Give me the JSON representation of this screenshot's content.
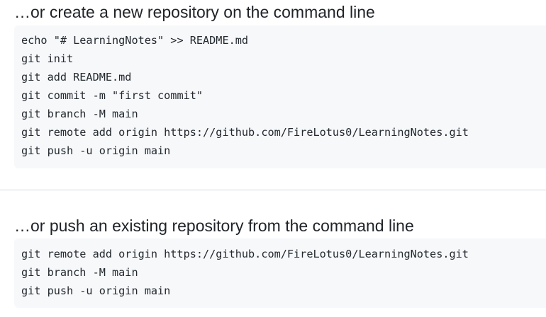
{
  "create_section": {
    "heading": "…or create a new repository on the command line",
    "commands": [
      "echo \"# LearningNotes\" >> README.md",
      "git init",
      "git add README.md",
      "git commit -m \"first commit\"",
      "git branch -M main",
      "git remote add origin https://github.com/FireLotus0/LearningNotes.git",
      "git push -u origin main"
    ]
  },
  "push_section": {
    "heading": "…or push an existing repository from the command line",
    "commands": [
      "git remote add origin https://github.com/FireLotus0/LearningNotes.git",
      "git branch -M main",
      "git push -u origin main"
    ]
  }
}
